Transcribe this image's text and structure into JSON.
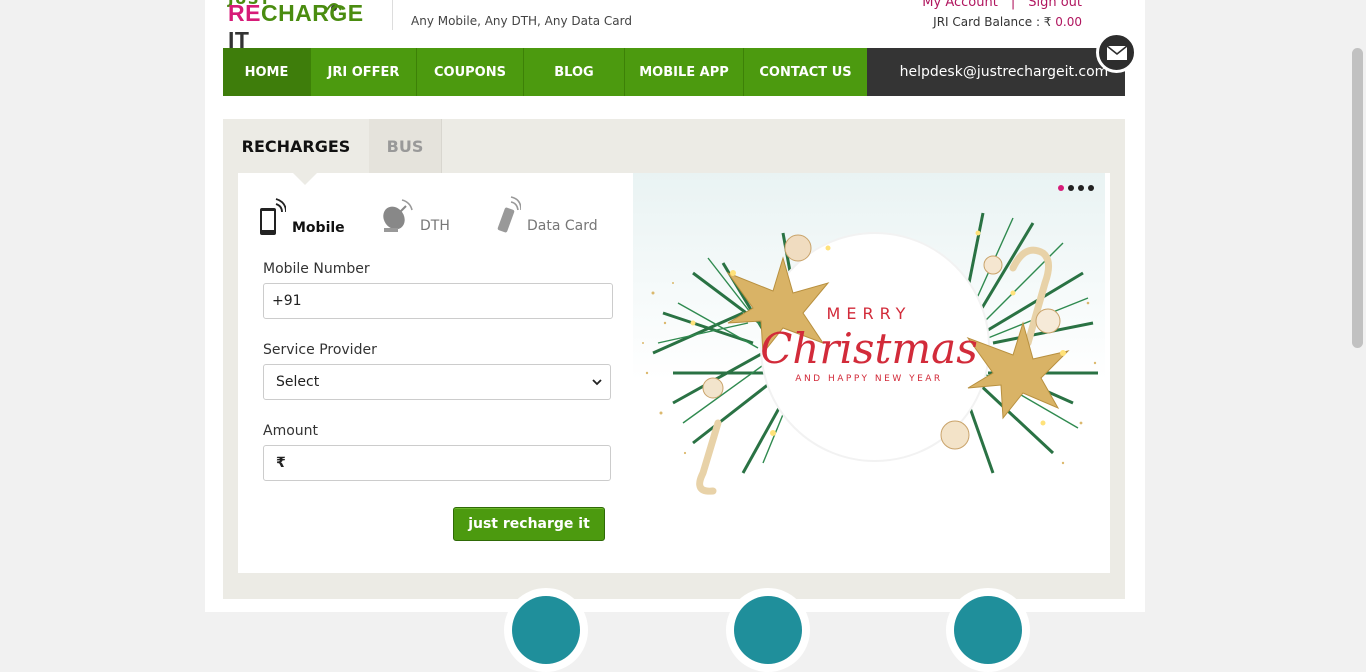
{
  "header": {
    "logo_top": "JUST",
    "logo_re": "RE",
    "logo_rest": "CHARGE ",
    "logo_it": "IT",
    "tagline": "Any Mobile, Any DTH, Any Data Card",
    "my_account": "My Account",
    "separator": "|",
    "sign_out": "Sign out",
    "balance_label": "JRI Card Balance : ₹",
    "balance_value": "0.00"
  },
  "nav": {
    "items": [
      {
        "label": "HOME"
      },
      {
        "label": "JRI OFFER"
      },
      {
        "label": "COUPONS"
      },
      {
        "label": "BLOG"
      },
      {
        "label": "MOBILE APP"
      },
      {
        "label": "CONTACT US"
      }
    ],
    "helpdesk_email": "helpdesk@justrechargeit.com"
  },
  "tabs": {
    "recharges": "RECHARGES",
    "bus": "BUS"
  },
  "services": {
    "mobile": "Mobile",
    "dth": "DTH",
    "data_card": "Data Card"
  },
  "form": {
    "mobile_label": "Mobile Number",
    "mobile_value": "+91",
    "provider_label": "Service Provider",
    "provider_value": "Select",
    "amount_label": "Amount",
    "amount_prefix": "₹",
    "submit": "just recharge it"
  },
  "banner": {
    "line1": "MERRY",
    "line2": "Christmas",
    "line3": "AND HAPPY NEW YEAR",
    "slide_count": 4,
    "active_slide": 1
  },
  "colors": {
    "brand_green": "#4c9a0f",
    "brand_pink": "#d61b78",
    "dark": "#343434"
  }
}
